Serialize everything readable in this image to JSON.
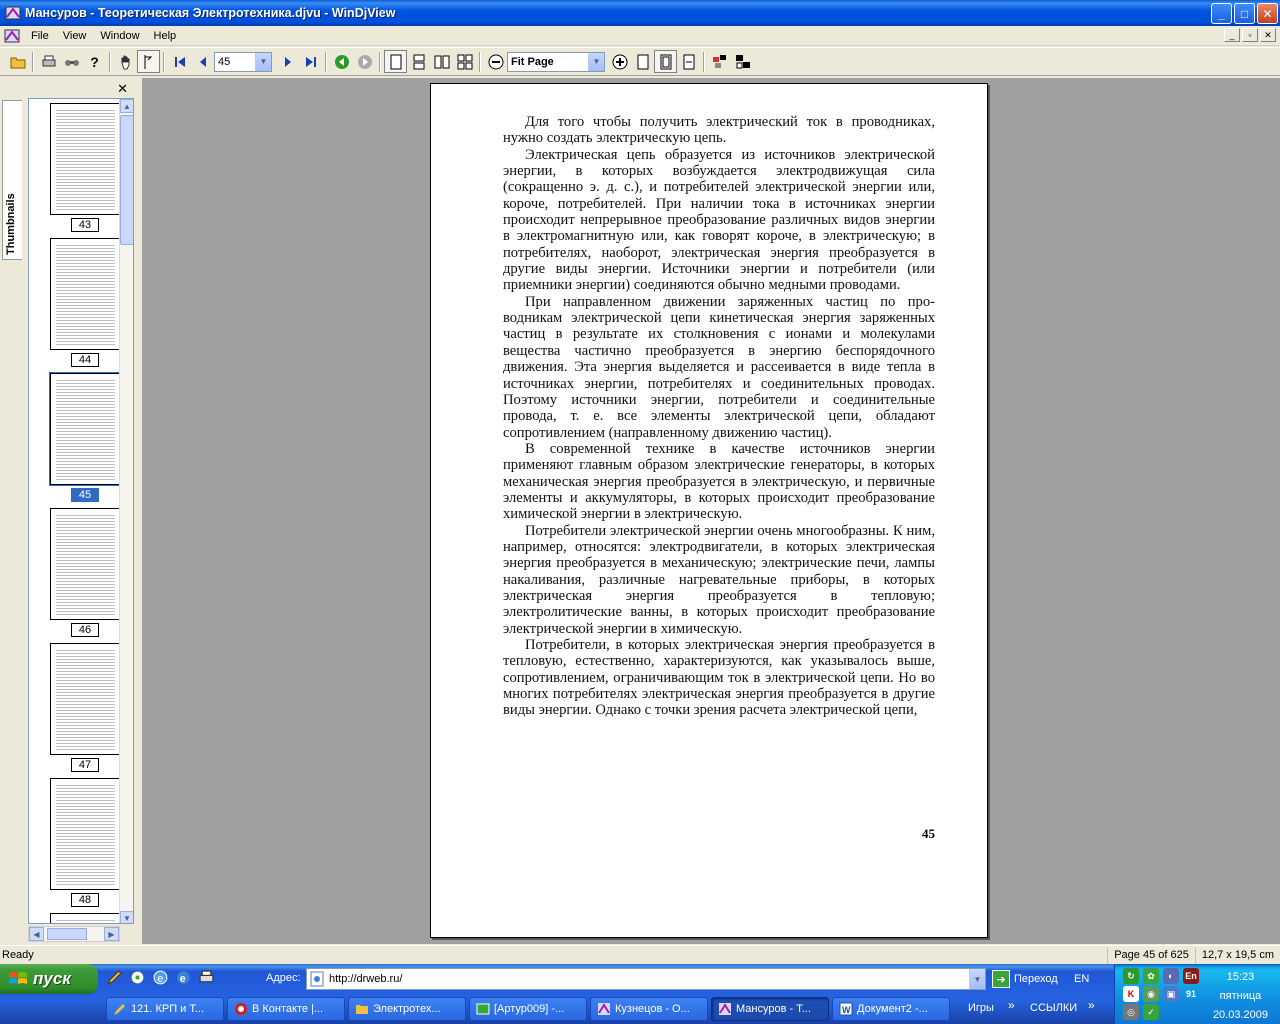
{
  "window": {
    "title": "Мансуров - Теоретическая Электротехника.djvu - WinDjView",
    "minimize": "_",
    "maximize": "□",
    "close": "✕"
  },
  "menu": {
    "items": [
      "File",
      "View",
      "Window",
      "Help"
    ]
  },
  "toolbar": {
    "page_value": "45",
    "zoom_value": "Fit Page"
  },
  "sidebar": {
    "tab_label": "Thumbnails",
    "close": "✕",
    "thumbnails": [
      "43",
      "44",
      "45",
      "46",
      "47",
      "48"
    ],
    "selected": "45"
  },
  "page": {
    "paragraphs": [
      "Для того чтобы получить электрический ток в провод­никах, нужно создать электрическую цепь.",
      "Электрическая цепь образуется из источников электрической энергии, в которых возбуж­дается электродвижущая сила (сокращенно э. д. с.), и потребителей электрической энергии или, короче, потребителей. При наличии тока в источниках энергии происходит непрерывное преобразование различ­ных видов энергии в электромагнитную или, как говорят короче, в электрическую; в потребителях, наоборот, элек­трическая энергия преобразуется в другие виды энергии. Источники энергии и потребители (или приемники энергии) соединяются обычно медными проводами.",
      "При направленном движении заряженных частиц по про­водникам электрической цепи кинетическая энергия заря­женных частиц в результате их столкновения с ионами и молекулами вещества частично преобразуется в энергию беспорядочного движения. Эта энергия выделяется и рас­сеивается в виде тепла в источниках энергии, потребителях и соединительных проводах. Поэтому источники энергии, потребители и соединительные провода, т. е. все элементы электрической цепи, обладают сопротивлением (направ­ленному движению частиц).",
      "В современной технике в качестве источников энергии применяют главным образом электрические ге­нераторы, в которых механическая энергия преобра­зуется в электрическую, и первичные элементы и аккуму­ляторы, в которых происходит преобразование химической энергии в электрическую.",
      "Потребители электрической энергии очень многообраз­ны. К ним, например, относятся: электродвигатели, в кото­рых электрическая энергия преобразуется в механическую; электрические печи, лампы накаливания, различные нагре­вательные приборы, в которых электрическая энергия пре­образуется в тепловую; электролитические ванны, в кото­рых происходит преобразование электрической энергии в химическую.",
      "Потребители, в которых электрическая энергия пре­образуется в тепловую, естественно, характеризуются, как указывалось выше, сопротивлением, ограничивающим ток в электрической цепи. Но во многих потребителях электрическая энергия преобразуется в другие виды энер­гии. Однако с точки зрения расчета электрической цепи,"
    ],
    "number": "45"
  },
  "status": {
    "left": "Ready",
    "page_info": "Page 45 of 625",
    "page_size": "12,7 x 19,5 cm"
  },
  "taskbar": {
    "start": "пуск",
    "address_label": "Адрес:",
    "address_value": "http://drweb.ru/",
    "go_label": "Переход",
    "lang": "EN",
    "games": "Игры",
    "links": "ССЫЛКИ",
    "tasks": [
      "121. КРП и Т...",
      "В Контакте |...",
      "Электротех...",
      "[Артур009] -...",
      "Кузнецов - О...",
      "Мансуров - Т...",
      "Документ2 -..."
    ],
    "active_task": 5,
    "tray_count": "91",
    "clock_time": "15:23",
    "clock_day": "пятница",
    "clock_date": "20.03.2009"
  }
}
